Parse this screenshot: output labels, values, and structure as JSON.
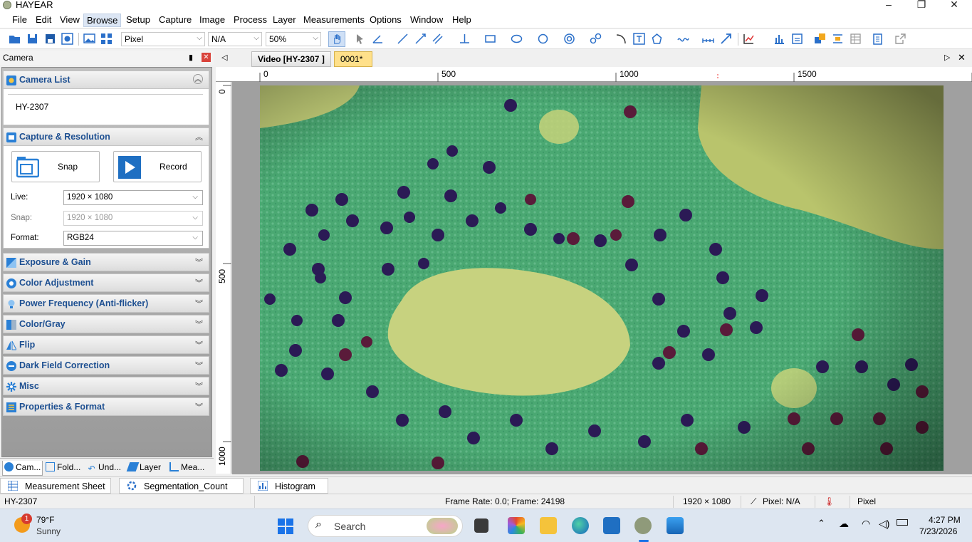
{
  "window": {
    "title": "HAYEAR",
    "controls": [
      "–",
      "❐",
      "✕"
    ]
  },
  "menu": [
    "File",
    "Edit",
    "View",
    "Browse",
    "Setup",
    "Capture",
    "Image",
    "Process",
    "Layer",
    "Measurements",
    "Options",
    "Window",
    "Help"
  ],
  "toolbar": {
    "unit": "Pixel",
    "measure": "N/A",
    "zoom": "50%"
  },
  "panel": {
    "title": "Camera",
    "camera_list": {
      "title": "Camera List",
      "device": "HY-2307"
    },
    "capture": {
      "title": "Capture & Resolution",
      "snap_label": "Snap",
      "record_label": "Record",
      "live_label": "Live:",
      "live_value": "1920 × 1080",
      "snap_res_label": "Snap:",
      "snap_res_value": "1920 × 1080",
      "format_label": "Format:",
      "format_value": "RGB24"
    },
    "sections": [
      "Exposure & Gain",
      "Color Adjustment",
      "Power Frequency (Anti-flicker)",
      "Color/Gray",
      "Flip",
      "Dark Field Correction",
      "Misc",
      "Properties & Format"
    ],
    "tabs": [
      "Cam...",
      "Fold...",
      "Und...",
      "Layer",
      "Mea..."
    ]
  },
  "document": {
    "tabs": [
      "Video [HY-2307 ]",
      "0001*"
    ],
    "ruler_h": [
      "0",
      "500",
      "1000",
      "1500"
    ],
    "ruler_v": [
      "0",
      "500",
      "1000"
    ]
  },
  "bottom_tabs": [
    "Measurement Sheet",
    "Segmentation_Count",
    "Histogram"
  ],
  "status": {
    "device": "HY-2307",
    "frame": "Frame Rate: 0.0; Frame: 24198",
    "resolution": "1920 × 1080",
    "pixel": "Pixel: N/A",
    "unit": "Pixel"
  },
  "taskbar": {
    "weather_badge": "1",
    "temperature": "79°F",
    "condition": "Sunny",
    "search_placeholder": "Search",
    "time": "4:27 PM",
    "date": "7/23/2026"
  },
  "colors": {
    "accent": "#1d4f91",
    "active_doc_tab": "#ffe08a",
    "stain_green": "#4fb07a"
  }
}
